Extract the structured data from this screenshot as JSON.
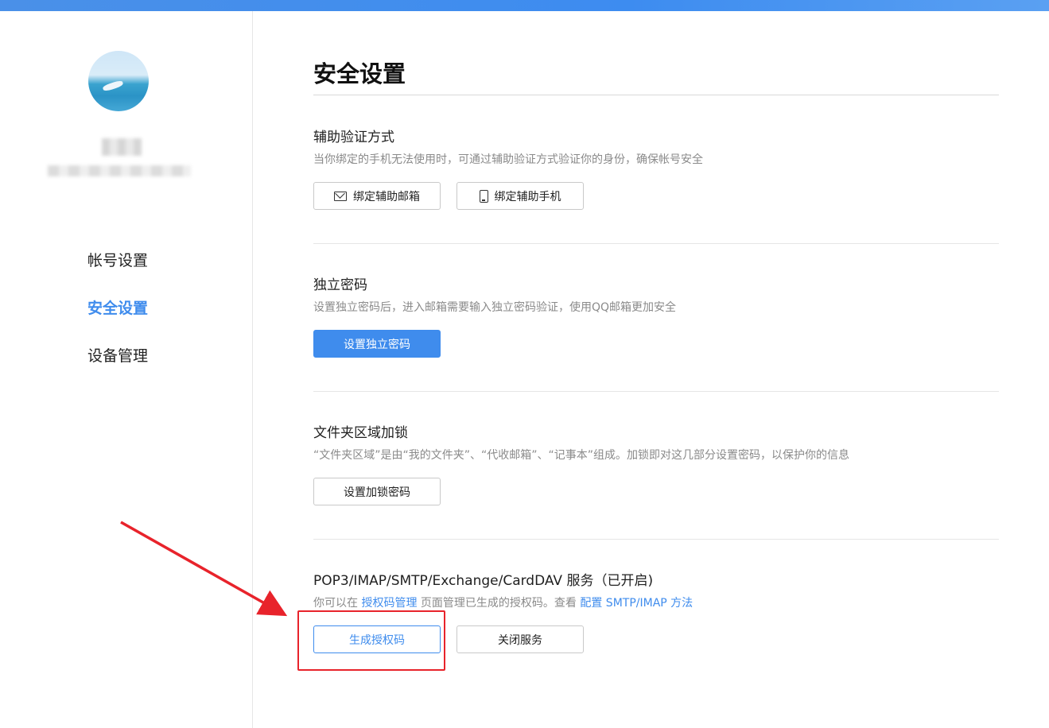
{
  "sidebar": {
    "nav": [
      {
        "label": "帐号设置",
        "active": false
      },
      {
        "label": "安全设置",
        "active": true
      },
      {
        "label": "设备管理",
        "active": false
      }
    ]
  },
  "main": {
    "title": "安全设置",
    "sections": [
      {
        "title": "辅助验证方式",
        "desc": "当你绑定的手机无法使用时，可通过辅助验证方式验证你的身份，确保帐号安全",
        "buttons": [
          {
            "label": "绑定辅助邮箱",
            "icon": "mail-icon"
          },
          {
            "label": "绑定辅助手机",
            "icon": "phone-icon"
          }
        ]
      },
      {
        "title": "独立密码",
        "desc": "设置独立密码后，进入邮箱需要输入独立密码验证，使用QQ邮箱更加安全",
        "buttons": [
          {
            "label": "设置独立密码",
            "style": "primary"
          }
        ]
      },
      {
        "title": "文件夹区域加锁",
        "desc": "“文件夹区域”是由“我的文件夹”、“代收邮箱”、“记事本”组成。加锁即对这几部分设置密码，以保护你的信息",
        "buttons": [
          {
            "label": "设置加锁密码"
          }
        ]
      },
      {
        "title": "POP3/IMAP/SMTP/Exchange/CardDAV 服务（已开启)",
        "desc_parts": {
          "prefix": "你可以在 ",
          "link1": "授权码管理",
          "middle": " 页面管理已生成的授权码。查看 ",
          "link2": "配置 SMTP/IMAP 方法"
        },
        "buttons": [
          {
            "label": "生成授权码",
            "style": "outline-blue"
          },
          {
            "label": "关闭服务"
          }
        ]
      }
    ]
  },
  "colors": {
    "accent": "#3f8ced",
    "annotation": "#e8232b"
  }
}
